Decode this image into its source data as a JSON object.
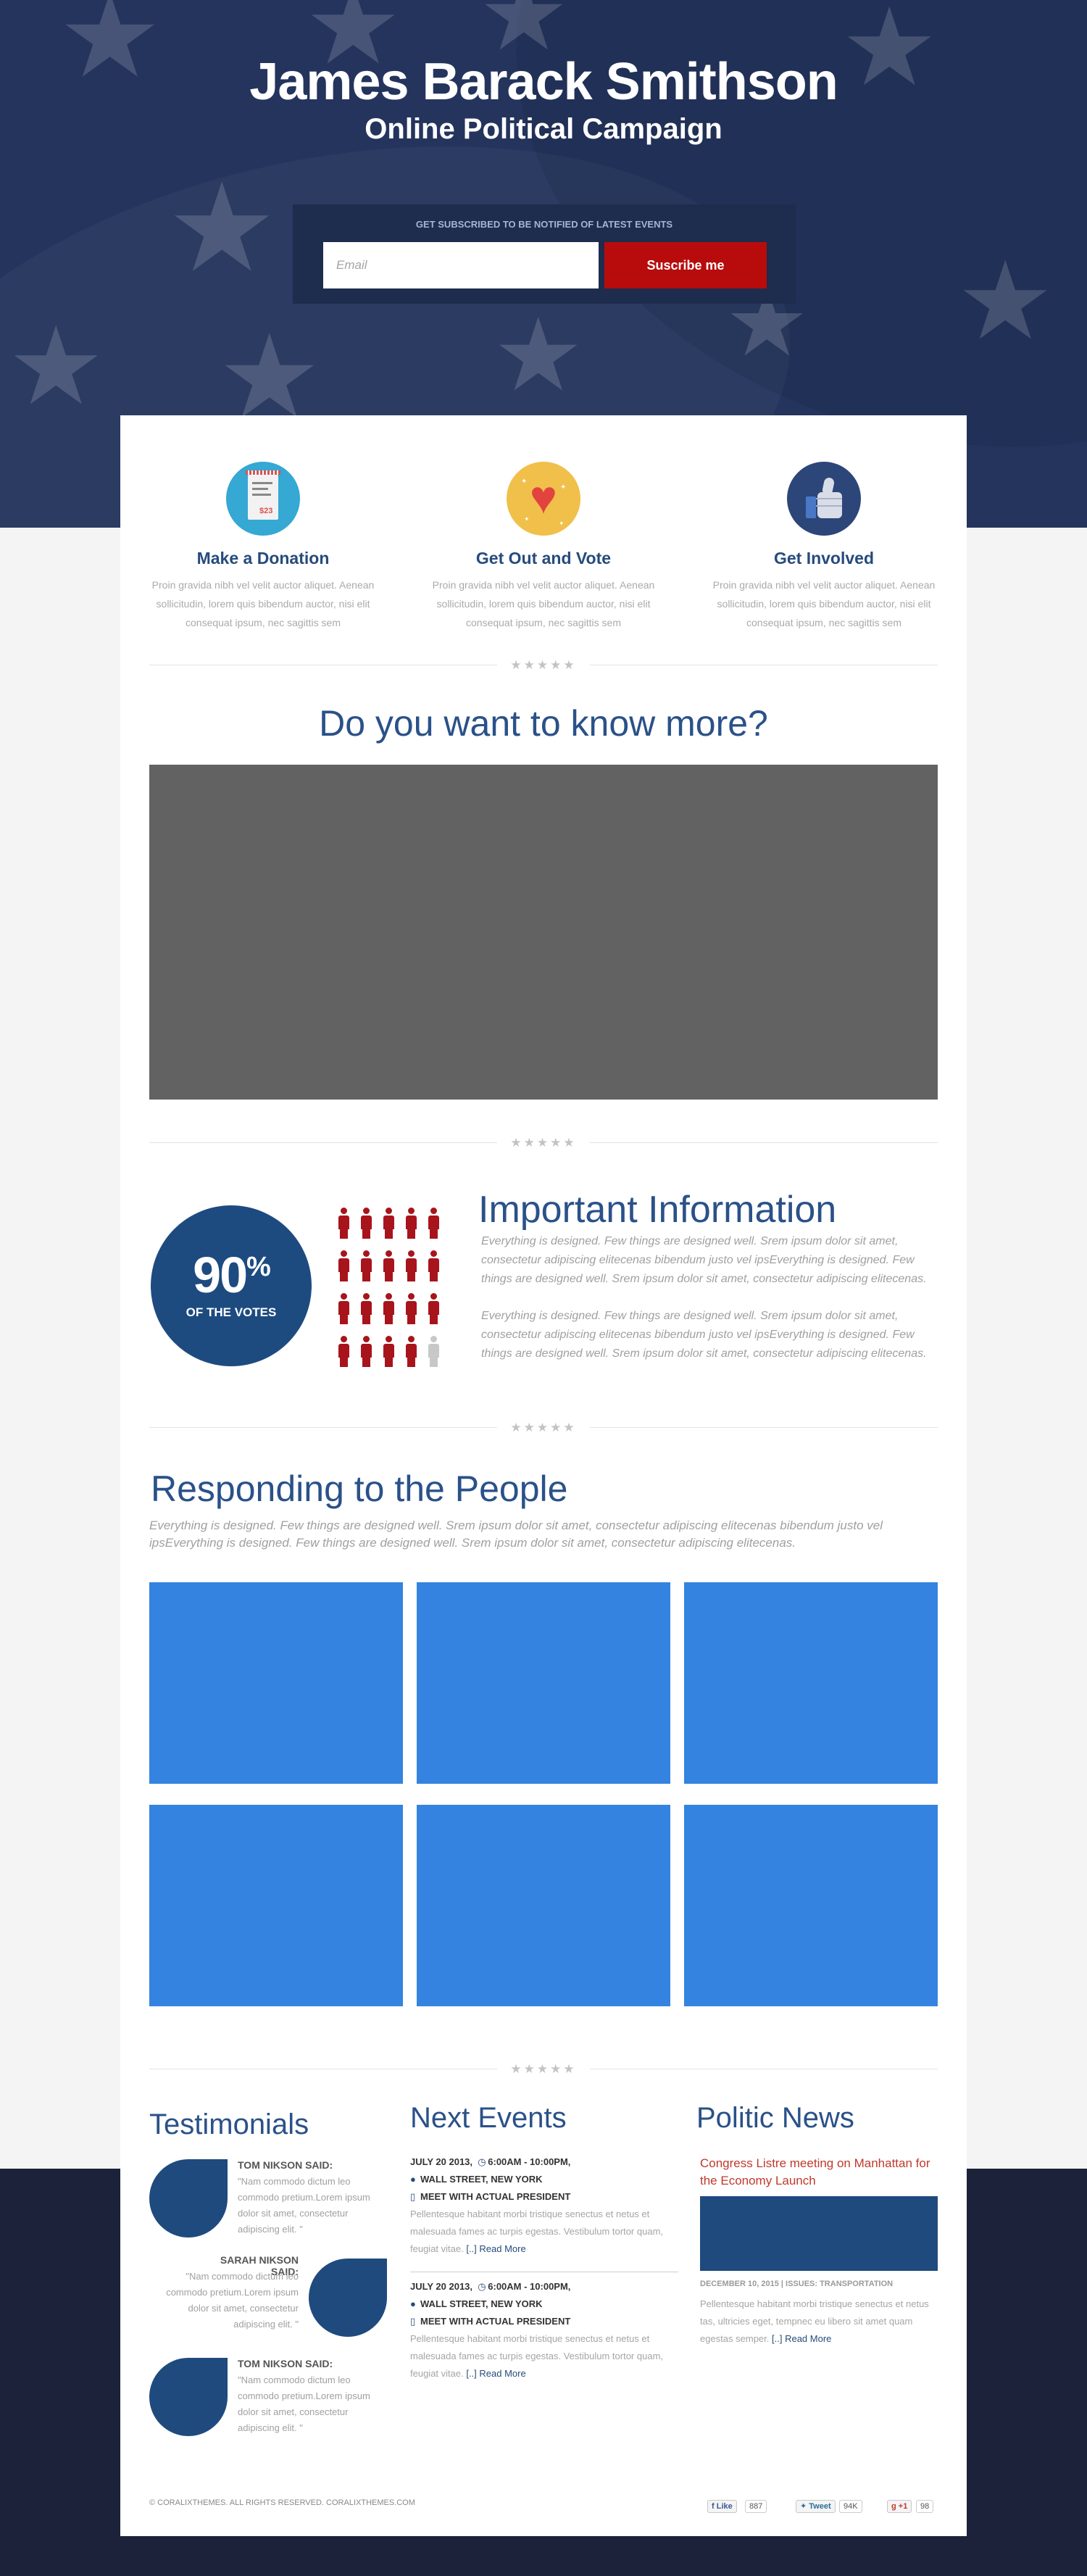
{
  "hero": {
    "title": "James Barack Smithson",
    "subtitle": "Online Political Campaign",
    "subscribe_label": "GET SUBSCRIBED TO BE NOTIFIED OF LATEST EVENTS",
    "email_placeholder": "Email",
    "subscribe_button": "Suscribe me"
  },
  "features": [
    {
      "title": "Make a Donation",
      "icon": "receipt-icon",
      "icon_text": "$23",
      "text": "Proin gravida nibh vel velit auctor aliquet. Aenean sollicitudin, lorem quis bibendum auctor, nisi elit consequat ipsum, nec sagittis sem"
    },
    {
      "title": "Get Out and Vote",
      "icon": "heart-icon",
      "text": "Proin gravida nibh vel velit auctor aliquet. Aenean sollicitudin, lorem quis bibendum auctor, nisi elit consequat ipsum, nec sagittis sem"
    },
    {
      "title": "Get Involved",
      "icon": "thumbs-up-icon",
      "text": "Proin gravida nibh vel velit auctor aliquet. Aenean sollicitudin, lorem quis bibendum auctor, nisi elit consequat ipsum, nec sagittis sem"
    }
  ],
  "divider_stars": "★★★★★",
  "video_section": {
    "title": "Do you want to know more?"
  },
  "votes": {
    "percent": "90",
    "percent_sign": "%",
    "label": "OF THE VOTES",
    "filled_people": 19,
    "total_people": 20
  },
  "info": {
    "title": "Important Information",
    "paragraph1": "Everything is designed. Few things are designed well. Srem ipsum dolor sit amet, consectetur adipiscing elitecenas bibendum justo vel ipsEverything is designed. Few things are designed well. Srem ipsum dolor sit amet, consectetur adipiscing elitecenas.",
    "paragraph2": "Everything is designed. Few things are designed well. Srem ipsum dolor sit amet, consectetur adipiscing elitecenas bibendum justo vel ipsEverything is designed. Few things are designed well. Srem ipsum dolor sit amet, consectetur adipiscing elitecenas."
  },
  "responding": {
    "title": "Responding to the People",
    "text": "Everything is designed. Few things are designed well. Srem ipsum dolor sit amet, consectetur adipiscing elitecenas bibendum justo vel ipsEverything is designed. Few things are designed well. Srem ipsum dolor sit amet, consectetur adipiscing elitecenas."
  },
  "testimonials": {
    "title": "Testimonials",
    "items": [
      {
        "name": "TOM NIKSON SAID:",
        "quote": "\"Nam commodo dictum leo commodo pretium.Lorem ipsum dolor sit amet, consectetur adipiscing elit. \""
      },
      {
        "name": "SARAH NIKSON SAID:",
        "quote": "\"Nam commodo dictum leo commodo pretium.Lorem ipsum dolor sit amet, consectetur adipiscing elit. \""
      },
      {
        "name": "TOM NIKSON SAID:",
        "quote": "\"Nam commodo dictum leo commodo pretium.Lorem ipsum dolor sit amet, consectetur adipiscing elit. \""
      }
    ]
  },
  "events": {
    "title": "Next Events",
    "items": [
      {
        "date": "JULY 20 2013,",
        "time": "6:00AM - 10:00PM,",
        "place": "WALL STREET, NEW YORK",
        "headline": "MEET WITH ACTUAL PRESIDENT",
        "desc": "Pellentesque habitant morbi tristique senectus et netus et malesuada fames ac turpis egestas. Vestibulum tortor quam, feugiat vitae.",
        "more": "[..] Read More"
      },
      {
        "date": "JULY 20 2013,",
        "time": "6:00AM - 10:00PM,",
        "place": "WALL STREET, NEW YORK",
        "headline": "MEET WITH ACTUAL PRESIDENT",
        "desc": "Pellentesque habitant morbi tristique senectus et netus et malesuada fames ac turpis egestas. Vestibulum tortor quam, feugiat vitae.",
        "more": "[..] Read More"
      }
    ]
  },
  "news": {
    "title": "Politic News",
    "headline": "Congress Listre meeting on Manhattan for the Economy Launch",
    "meta": "DECEMBER 10, 2015 | ISSUES: TRANSPORTATION",
    "text": "Pellentesque habitant morbi tristique senectus et netus tas, ultricies eget, tempnec eu libero sit amet quam egestas semper.",
    "more": "[..] Read More"
  },
  "footer": {
    "copyright": "© CORALIXTHEMES. ALL RIGHTS RESERVED. CORALIXTHEMES.COM",
    "like_label": "Like",
    "like_count": "887",
    "tweet_label": "Tweet",
    "tweet_count": "94K",
    "plus_label": "+1",
    "plus_count": "98"
  },
  "colors": {
    "hero_bg": "#24345d",
    "accent_blue": "#2a5189",
    "button_red": "#b80c0c",
    "tile_blue": "#3483e0",
    "footer_bg": "#1b2239"
  }
}
